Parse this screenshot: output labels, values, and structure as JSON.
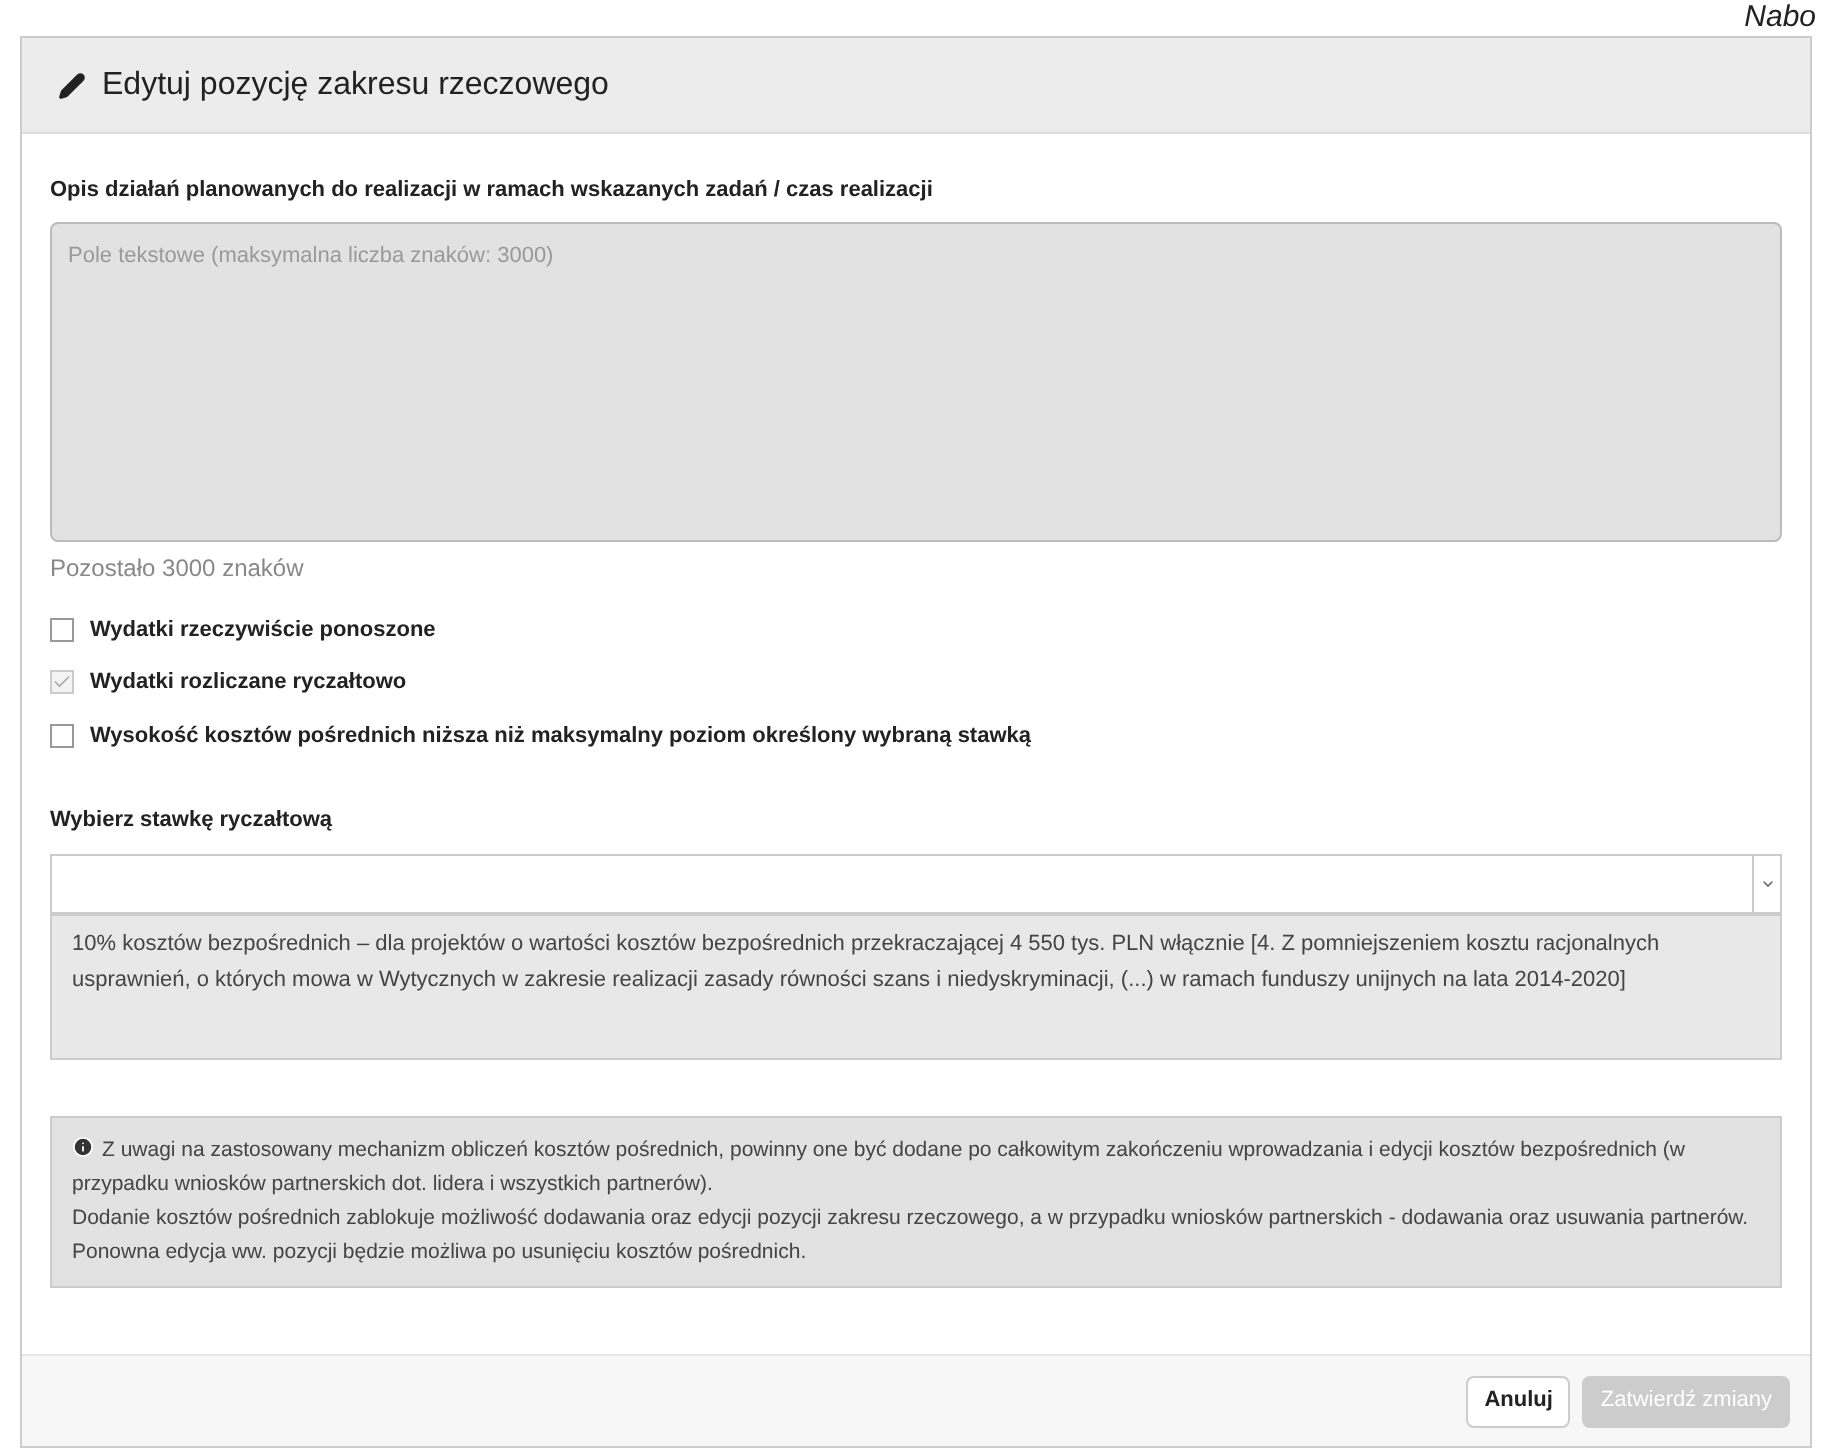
{
  "background_text": "Nabo",
  "dialog": {
    "title": "Edytuj pozycję zakresu rzeczowego",
    "description": {
      "label": "Opis działań planowanych do realizacji w ramach wskazanych zadań / czas realizacji",
      "placeholder": "Pole tekstowe (maksymalna liczba znaków: 3000)",
      "counter": "Pozostało 3000 znaków"
    },
    "checkboxes": [
      {
        "label": "Wydatki rzeczywiście ponoszone",
        "checked": false,
        "disabled": false
      },
      {
        "label": "Wydatki rozliczane ryczałtowo",
        "checked": true,
        "disabled": true
      },
      {
        "label": "Wysokość kosztów pośrednich niższa niż maksymalny poziom określony wybraną stawką",
        "checked": false,
        "disabled": false
      }
    ],
    "rate": {
      "label": "Wybierz stawkę ryczałtową",
      "option_text": "10% kosztów bezpośrednich – dla projektów o wartości kosztów bezpośrednich przekraczającej 4 550 tys. PLN włącznie [4. Z pomniejszeniem kosztu racjonalnych usprawnień, o których mowa w Wytycznych w zakresie realizacji zasady równości szans i niedyskryminacji, (...) w ramach funduszy unijnych na lata 2014-2020]"
    },
    "info": [
      "Z uwagi na zastosowany mechanizm obliczeń kosztów pośrednich, powinny one być dodane po całkowitym zakończeniu wprowadzania i edycji kosztów bezpośrednich (w przypadku wniosków partnerskich dot. lidera i wszystkich partnerów).",
      "Dodanie kosztów pośrednich zablokuje możliwość dodawania oraz edycji pozycji zakresu rzeczowego, a w przypadku wniosków partnerskich - dodawania oraz usuwania partnerów. Ponowna edycja ww. pozycji będzie możliwa po usunięciu kosztów pośrednich."
    ],
    "buttons": [
      {
        "label": "Anuluj",
        "disabled": false
      },
      {
        "label": "Zatwierdź zmiany",
        "disabled": true
      }
    ]
  }
}
